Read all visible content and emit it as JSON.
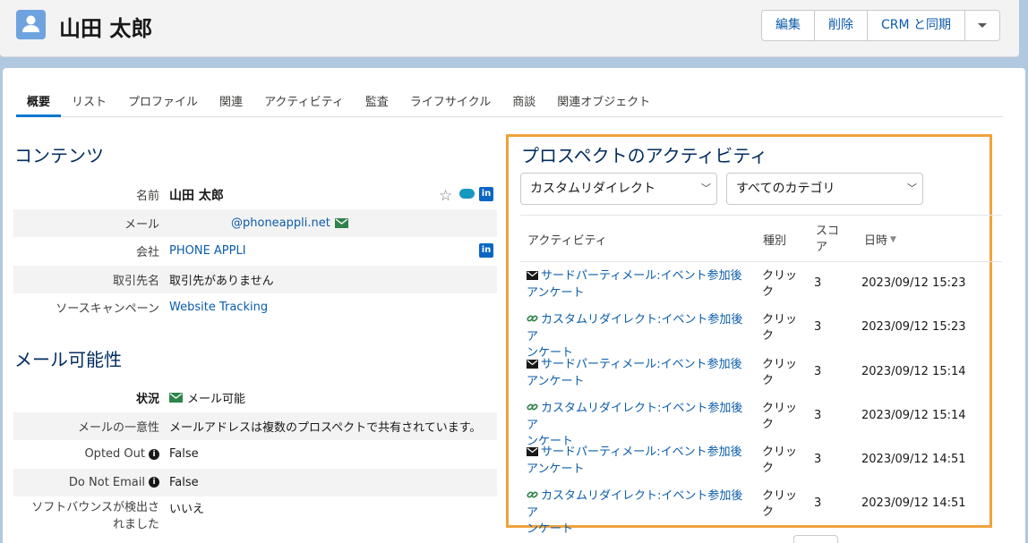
{
  "header": {
    "title": "山田 太郎",
    "buttons": {
      "edit": "編集",
      "delete": "削除",
      "sync": "CRM と同期"
    }
  },
  "tabs": [
    "概要",
    "リスト",
    "プロファイル",
    "関連",
    "アクティビティ",
    "監査",
    "ライフサイクル",
    "商談",
    "関連オブジェクト"
  ],
  "contents": {
    "heading": "コンテンツ",
    "rows": [
      {
        "label": "名前",
        "value": "山田 太郎"
      },
      {
        "label": "メール",
        "value": "@phoneappli.net"
      },
      {
        "label": "会社",
        "value": "PHONE APPLI"
      },
      {
        "label": "取引先名",
        "value": "取引先がありません"
      },
      {
        "label": "ソースキャンペーン",
        "value": "Website Tracking"
      }
    ]
  },
  "mailability": {
    "heading": "メール可能性",
    "rows": [
      {
        "label": "状況",
        "value": "メール可能"
      },
      {
        "label": "メールの一意性",
        "value": "メールアドレスは複数のプロスペクトで共有されています。"
      },
      {
        "label": "Opted Out",
        "value": "False"
      },
      {
        "label": "Do Not Email",
        "value": "False"
      },
      {
        "label": "ソフトバウンスが検出さ",
        "label2": "れました",
        "value": "いいえ"
      }
    ]
  },
  "activity": {
    "heading": "プロスペクトのアクティビティ",
    "filter_type": "カスタムリダイレクト",
    "filter_category": "すべてのカテゴリ",
    "columns": {
      "activity": "アクティビティ",
      "type": "種別",
      "score_1": "スコ",
      "score_2": "ア",
      "date": "日時"
    },
    "rows": [
      {
        "icon": "envelope-icon",
        "line1": "サードパーティメール:イベント参加後",
        "line2": "アンケート",
        "type_1": "クリッ",
        "type_2": "ク",
        "score": "3",
        "date": "2023/09/12 15:23"
      },
      {
        "icon": "link-icon",
        "line1": "カスタムリダイレクト:イベント参加後ア",
        "line2": "ンケート",
        "type_1": "クリッ",
        "type_2": "ク",
        "score": "3",
        "date": "2023/09/12 15:23"
      },
      {
        "icon": "envelope-icon",
        "line1": "サードパーティメール:イベント参加後",
        "line2": "アンケート",
        "type_1": "クリッ",
        "type_2": "ク",
        "score": "3",
        "date": "2023/09/12 15:14"
      },
      {
        "icon": "link-icon",
        "line1": "カスタムリダイレクト:イベント参加後ア",
        "line2": "ンケート",
        "type_1": "クリッ",
        "type_2": "ク",
        "score": "3",
        "date": "2023/09/12 15:14"
      },
      {
        "icon": "envelope-icon",
        "line1": "サードパーティメール:イベント参加後",
        "line2": "アンケート",
        "type_1": "クリッ",
        "type_2": "ク",
        "score": "3",
        "date": "2023/09/12 14:51"
      },
      {
        "icon": "link-icon",
        "line1": "カスタムリダイレクト:イベント参加後ア",
        "line2": "ンケート",
        "type_1": "クリッ",
        "type_2": "ク",
        "score": "3",
        "date": "2023/09/12 14:51"
      }
    ]
  },
  "colors": {
    "accent": "#0176d3",
    "link": "#0b5cab",
    "highlight": "#f0a23c",
    "heading": "#032d60"
  }
}
